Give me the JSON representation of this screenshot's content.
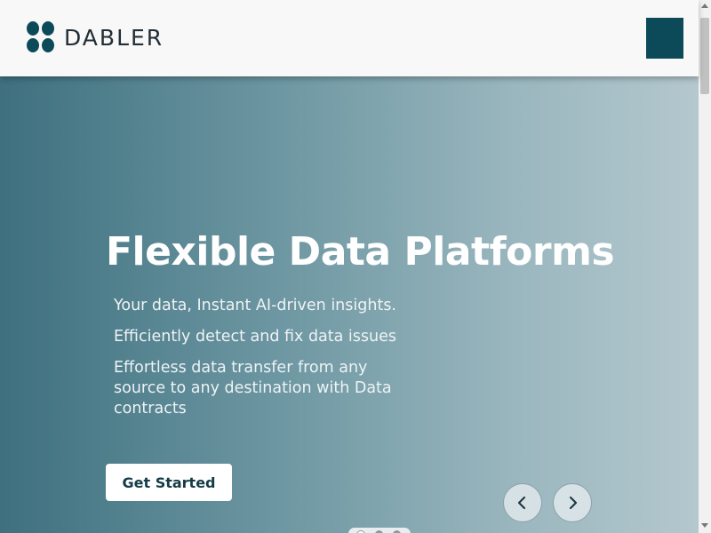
{
  "header": {
    "logo_text": "DABLER",
    "menu_icon": "menu-icon"
  },
  "hero": {
    "title": "Flexible Data Platforms",
    "lines": [
      "Your data, Instant AI-driven insights.",
      "Efficiently detect and fix data issues",
      "Effortless data transfer from any source to any destination with Data contracts"
    ],
    "cta_label": "Get Started"
  },
  "carousel": {
    "prev_icon": "chevron-left-icon",
    "next_icon": "chevron-right-icon",
    "dot_count": 3,
    "active_dot": 1
  },
  "colors": {
    "brand": "#0c4a5a",
    "gradient_start": "#3e707f",
    "gradient_end": "#b4c8ce"
  }
}
